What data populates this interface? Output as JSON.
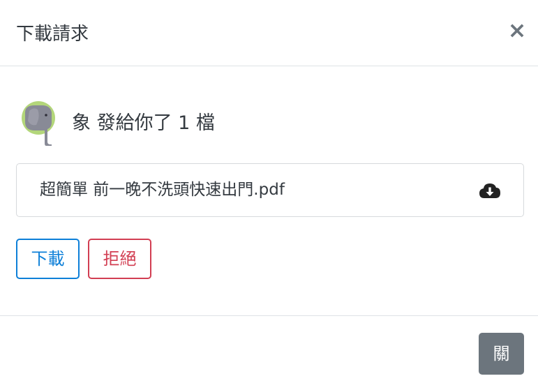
{
  "modal": {
    "title": "下載請求",
    "close_symbol": "×"
  },
  "sender": {
    "avatar_icon": "elephant-avatar-icon",
    "message": "象 發給你了 1 檔"
  },
  "file": {
    "name": "超簡單 前一晚不洗頭快速出門.pdf",
    "action_icon": "cloud-download-icon"
  },
  "actions": {
    "download_label": "下載",
    "reject_label": "拒絕"
  },
  "footer": {
    "close_label": "關"
  },
  "colors": {
    "download_accent": "#0d7fd8",
    "reject_accent": "#d23e52",
    "footer_button": "#6c757d",
    "avatar_bg": "#b3d67a",
    "elephant": "#888a96"
  }
}
